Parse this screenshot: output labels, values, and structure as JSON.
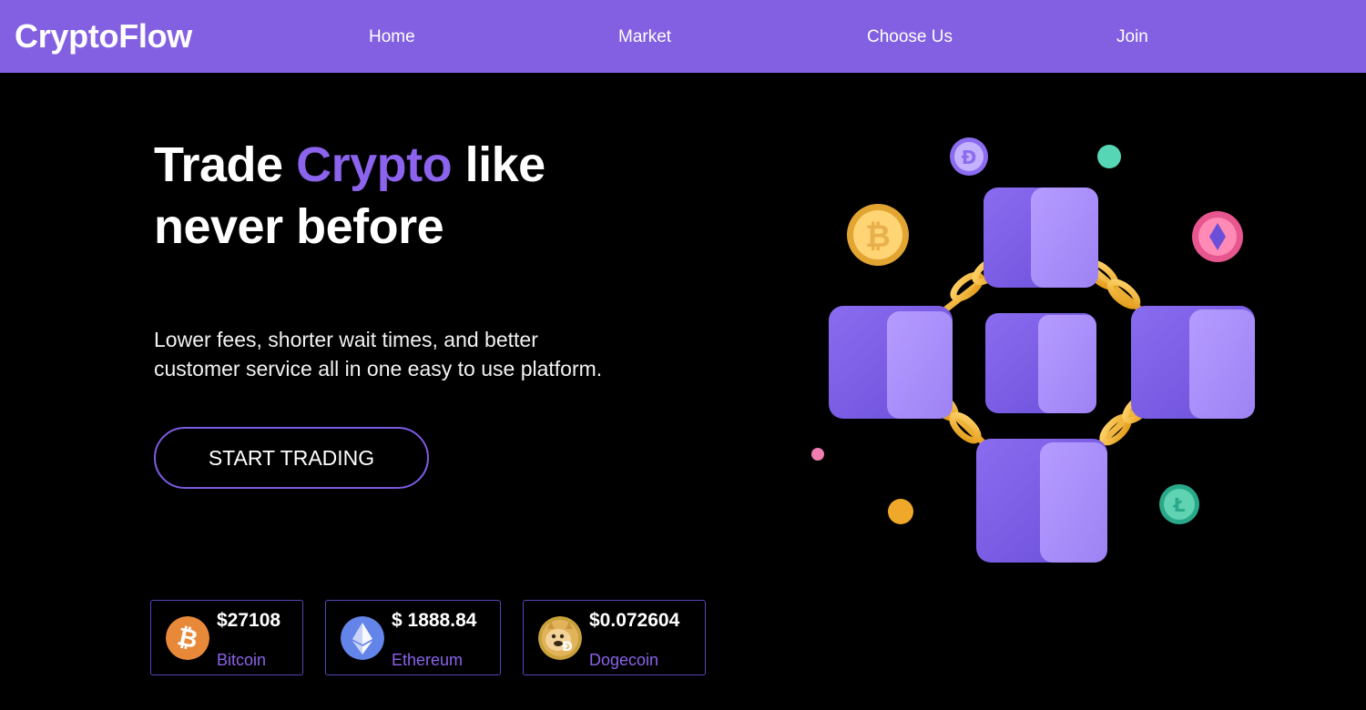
{
  "brand": {
    "name": "CryptoFlow",
    "accent_color": "#8360e2",
    "highlight_color": "#8b63ec"
  },
  "nav": {
    "links": [
      {
        "label": "Home"
      },
      {
        "label": "Market"
      },
      {
        "label": "Choose Us"
      },
      {
        "label": "Join"
      }
    ]
  },
  "hero": {
    "title_part1": "Trade ",
    "title_accent": "Crypto",
    "title_part2": " like",
    "title_line2": "never before",
    "subtitle_line1": "Lower fees, shorter wait times, and better",
    "subtitle_line2": "customer service all in one easy to use platform.",
    "cta_label": "START TRADING",
    "illustration_icon": "blockchain-cubes-illustration"
  },
  "prices": [
    {
      "price": "$27108",
      "name": "Bitcoin",
      "icon": "bitcoin-icon",
      "color": "#f7931a"
    },
    {
      "price": "$ 1888.84",
      "name": "Ethereum",
      "icon": "ethereum-icon",
      "color": "#627eea"
    },
    {
      "price": "$0.072604",
      "name": "Dogecoin",
      "icon": "dogecoin-icon",
      "color": "#c2a633"
    }
  ]
}
